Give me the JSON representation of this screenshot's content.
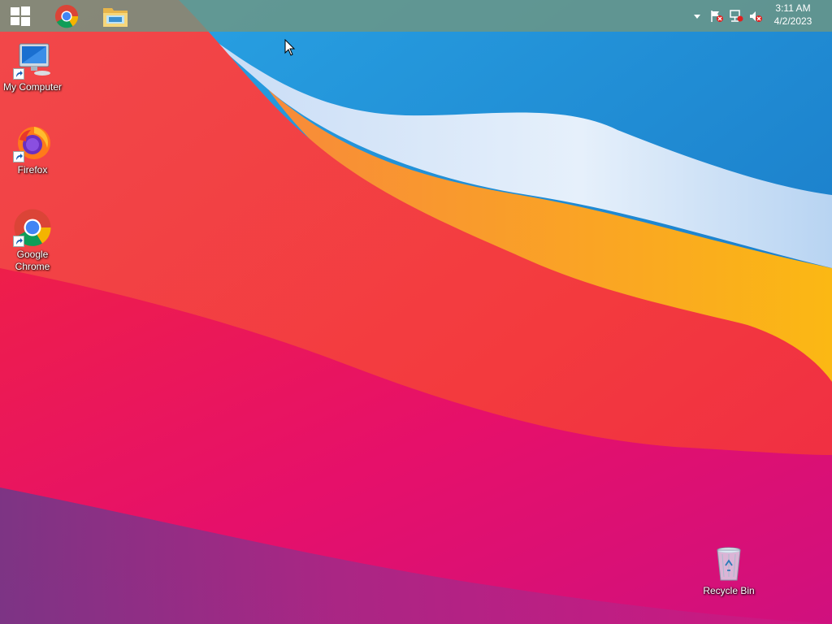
{
  "taskbar": {
    "start_icon": "windows-logo-icon",
    "pinned": [
      {
        "name": "Google Chrome",
        "icon": "chrome-icon"
      },
      {
        "name": "File Explorer",
        "icon": "folder-icon"
      }
    ],
    "tray_icons": [
      "chevron-up-icon",
      "action-center-flag-icon",
      "network-icon",
      "volume-muted-icon"
    ],
    "clock": {
      "time": "3:11 AM",
      "date": "4/2/2023"
    }
  },
  "desktop": {
    "icons": [
      {
        "label": "My Computer",
        "icon": "computer-icon"
      },
      {
        "label": "Firefox",
        "icon": "firefox-icon"
      },
      {
        "label": "Google Chrome",
        "icon": "chrome-icon"
      },
      {
        "label": "Recycle Bin",
        "icon": "recycle-bin-icon"
      }
    ]
  },
  "colors": {
    "taskbar": "#6e9682",
    "wallpaper_red": "#f0303c",
    "wallpaper_blue": "#1e8fd8",
    "wallpaper_orange": "#f8a020",
    "wallpaper_magenta": "#d0107a"
  }
}
